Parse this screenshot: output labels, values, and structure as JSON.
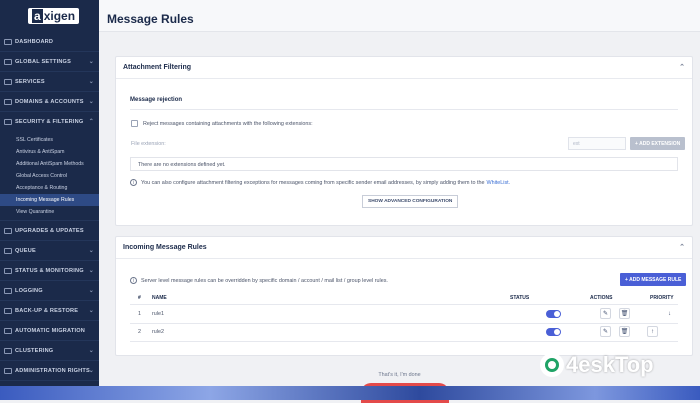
{
  "logo": {
    "mark": "a",
    "rest": "xigen"
  },
  "page_title": "Message Rules",
  "sidebar": {
    "items": [
      {
        "label": "DASHBOARD",
        "chevron": false
      },
      {
        "label": "GLOBAL SETTINGS",
        "chevron": true
      },
      {
        "label": "SERVICES",
        "chevron": true
      },
      {
        "label": "DOMAINS & ACCOUNTS",
        "chevron": true
      },
      {
        "label": "SECURITY & FILTERING",
        "chevron": true
      }
    ],
    "sub_items": [
      {
        "label": "SSL Certificates"
      },
      {
        "label": "Antivirus & AntiSpam"
      },
      {
        "label": "Additional AntiSpam Methods"
      },
      {
        "label": "Global Access Control"
      },
      {
        "label": "Acceptance & Routing"
      },
      {
        "label": "Incoming Message Rules",
        "active": true
      },
      {
        "label": "View Quarantine"
      }
    ],
    "items_after": [
      {
        "label": "UPGRADES & UPDATES"
      },
      {
        "label": "QUEUE"
      },
      {
        "label": "STATUS & MONITORING"
      },
      {
        "label": "LOGGING"
      },
      {
        "label": "BACK-UP & RESTORE"
      },
      {
        "label": "AUTOMATIC MIGRATION"
      },
      {
        "label": "CLUSTERING"
      },
      {
        "label": "ADMINISTRATION RIGHTS"
      }
    ]
  },
  "attachment": {
    "title": "Attachment Filtering",
    "section_title": "Message rejection",
    "checkbox_label": "Reject messages containing attachments with the following extensions:",
    "file_ext_label": "File extension:",
    "ext_placeholder": "ext",
    "add_ext_button": "+ ADD EXTENSION",
    "empty_text": "There are no extensions defined yet.",
    "info_text": "You can also configure attachment filtering exceptions for messages coming from specific sender email addresses, by simply adding them to the",
    "info_link": "WhiteList.",
    "advanced_button": "SHOW ADVANCED CONFIGURATION"
  },
  "incoming": {
    "title": "Incoming Message Rules",
    "info_text": "Server level message rules can be overridden by specific domain / account / mail list / group level rules.",
    "add_button": "+ ADD MESSAGE RULE",
    "columns": {
      "num": "#",
      "name": "NAME",
      "status": "STATUS",
      "actions": "ACTIONS",
      "priority": "PRIORITY"
    },
    "rows": [
      {
        "num": "1",
        "name": "rule1",
        "status": "on",
        "priority_arrow": "↓"
      },
      {
        "num": "2",
        "name": "rule2",
        "status": "on",
        "priority_arrow": "↑"
      }
    ]
  },
  "footer_note": "That's it, I'm done",
  "watermark": "4eskTop",
  "colors": {
    "sidebar_bg": "#1b2a4a",
    "accent": "#4a5fd6",
    "active_item": "#2e4a85"
  }
}
